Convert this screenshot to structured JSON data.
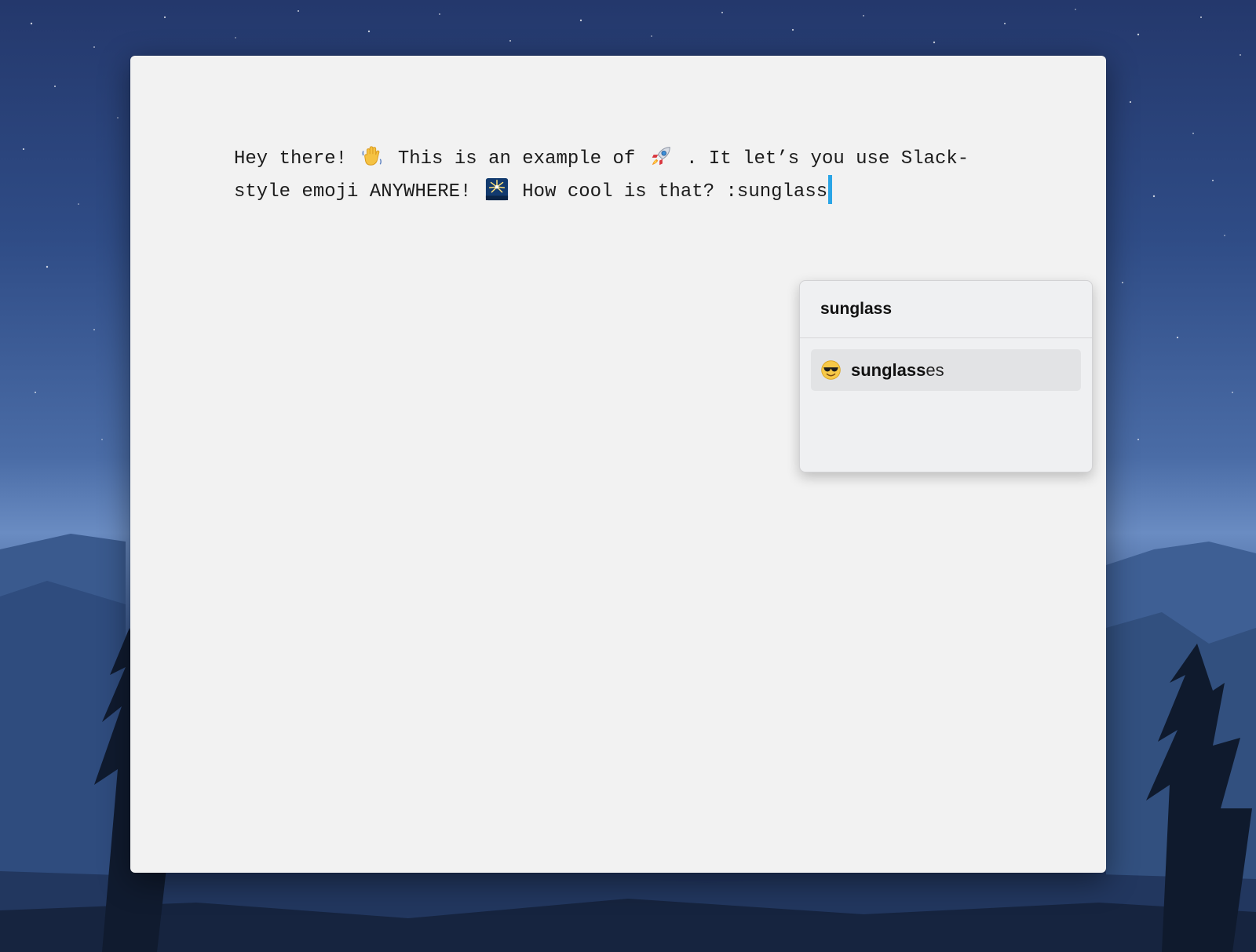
{
  "editor": {
    "line1": {
      "text_a": "Hey there!",
      "emoji_a": "waving-hand-icon",
      "text_b": "This is an example of",
      "emoji_b": "rocket-icon",
      "text_c": ". It let’s you use Slack-"
    },
    "line2": {
      "text_a": "style emoji ANYWHERE!",
      "emoji_a": "fireworks-icon",
      "text_b": "How cool is that? :sunglass"
    },
    "caret_color": "#2aa5e6"
  },
  "autocomplete": {
    "query": "sunglass",
    "suggestions": [
      {
        "emoji": "smiling-face-with-sunglasses-icon",
        "match": "sunglass",
        "rest": "es",
        "selected": true
      }
    ]
  },
  "colors": {
    "window_bg": "#f2f2f2",
    "popup_bg": "#eff0f2",
    "selected_row": "#e2e3e5"
  }
}
